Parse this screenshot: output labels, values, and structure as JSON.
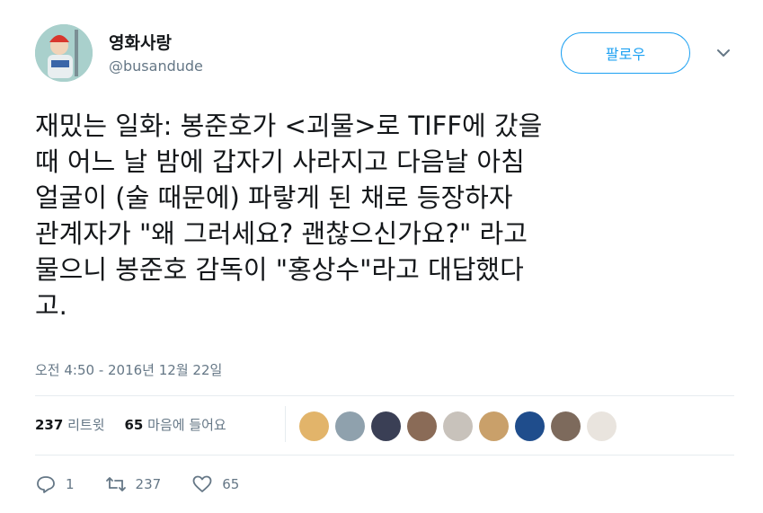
{
  "user": {
    "display_name": "영화사랑",
    "handle": "@busandude"
  },
  "follow_button_label": "팔로우",
  "tweet": {
    "text": "재밌는 일화: 봉준호가 <괴물>로 TIFF에 갔을\n때 어느 날 밤에 갑자기 사라지고 다음날 아침\n얼굴이 (술 때문에) 파랗게 된 채로 등장하자\n관계자가 \"왜 그러세요? 괜찮으신가요?\" 라고\n물으니 봉준호 감독이 \"홍상수\"라고 대답했다\n고.",
    "timestamp": "오전 4:50 - 2016년 12월 22일"
  },
  "stats": {
    "retweets_count": "237",
    "retweets_label": "리트윗",
    "likes_count": "65",
    "likes_label": "마음에 들어요"
  },
  "liker_avatars": [
    {
      "icon": "user-avatar-icon",
      "color": "#e2b46a"
    },
    {
      "icon": "user-avatar-icon",
      "color": "#8fa1ad"
    },
    {
      "icon": "user-avatar-icon",
      "color": "#3a3f55"
    },
    {
      "icon": "user-avatar-icon",
      "color": "#8a6b57"
    },
    {
      "icon": "user-avatar-icon",
      "color": "#c8c2bb"
    },
    {
      "icon": "user-avatar-icon",
      "color": "#c9a06a"
    },
    {
      "icon": "user-avatar-icon",
      "color": "#1f4d8c"
    },
    {
      "icon": "user-avatar-icon",
      "color": "#7d6a5c"
    },
    {
      "icon": "user-avatar-icon",
      "color": "#e9e4de"
    }
  ],
  "actions": {
    "reply_count": "1",
    "retweet_count": "237",
    "like_count": "65"
  },
  "colors": {
    "accent": "#1da1f2",
    "secondary_text": "#657786",
    "divider": "#e6ecf0"
  }
}
